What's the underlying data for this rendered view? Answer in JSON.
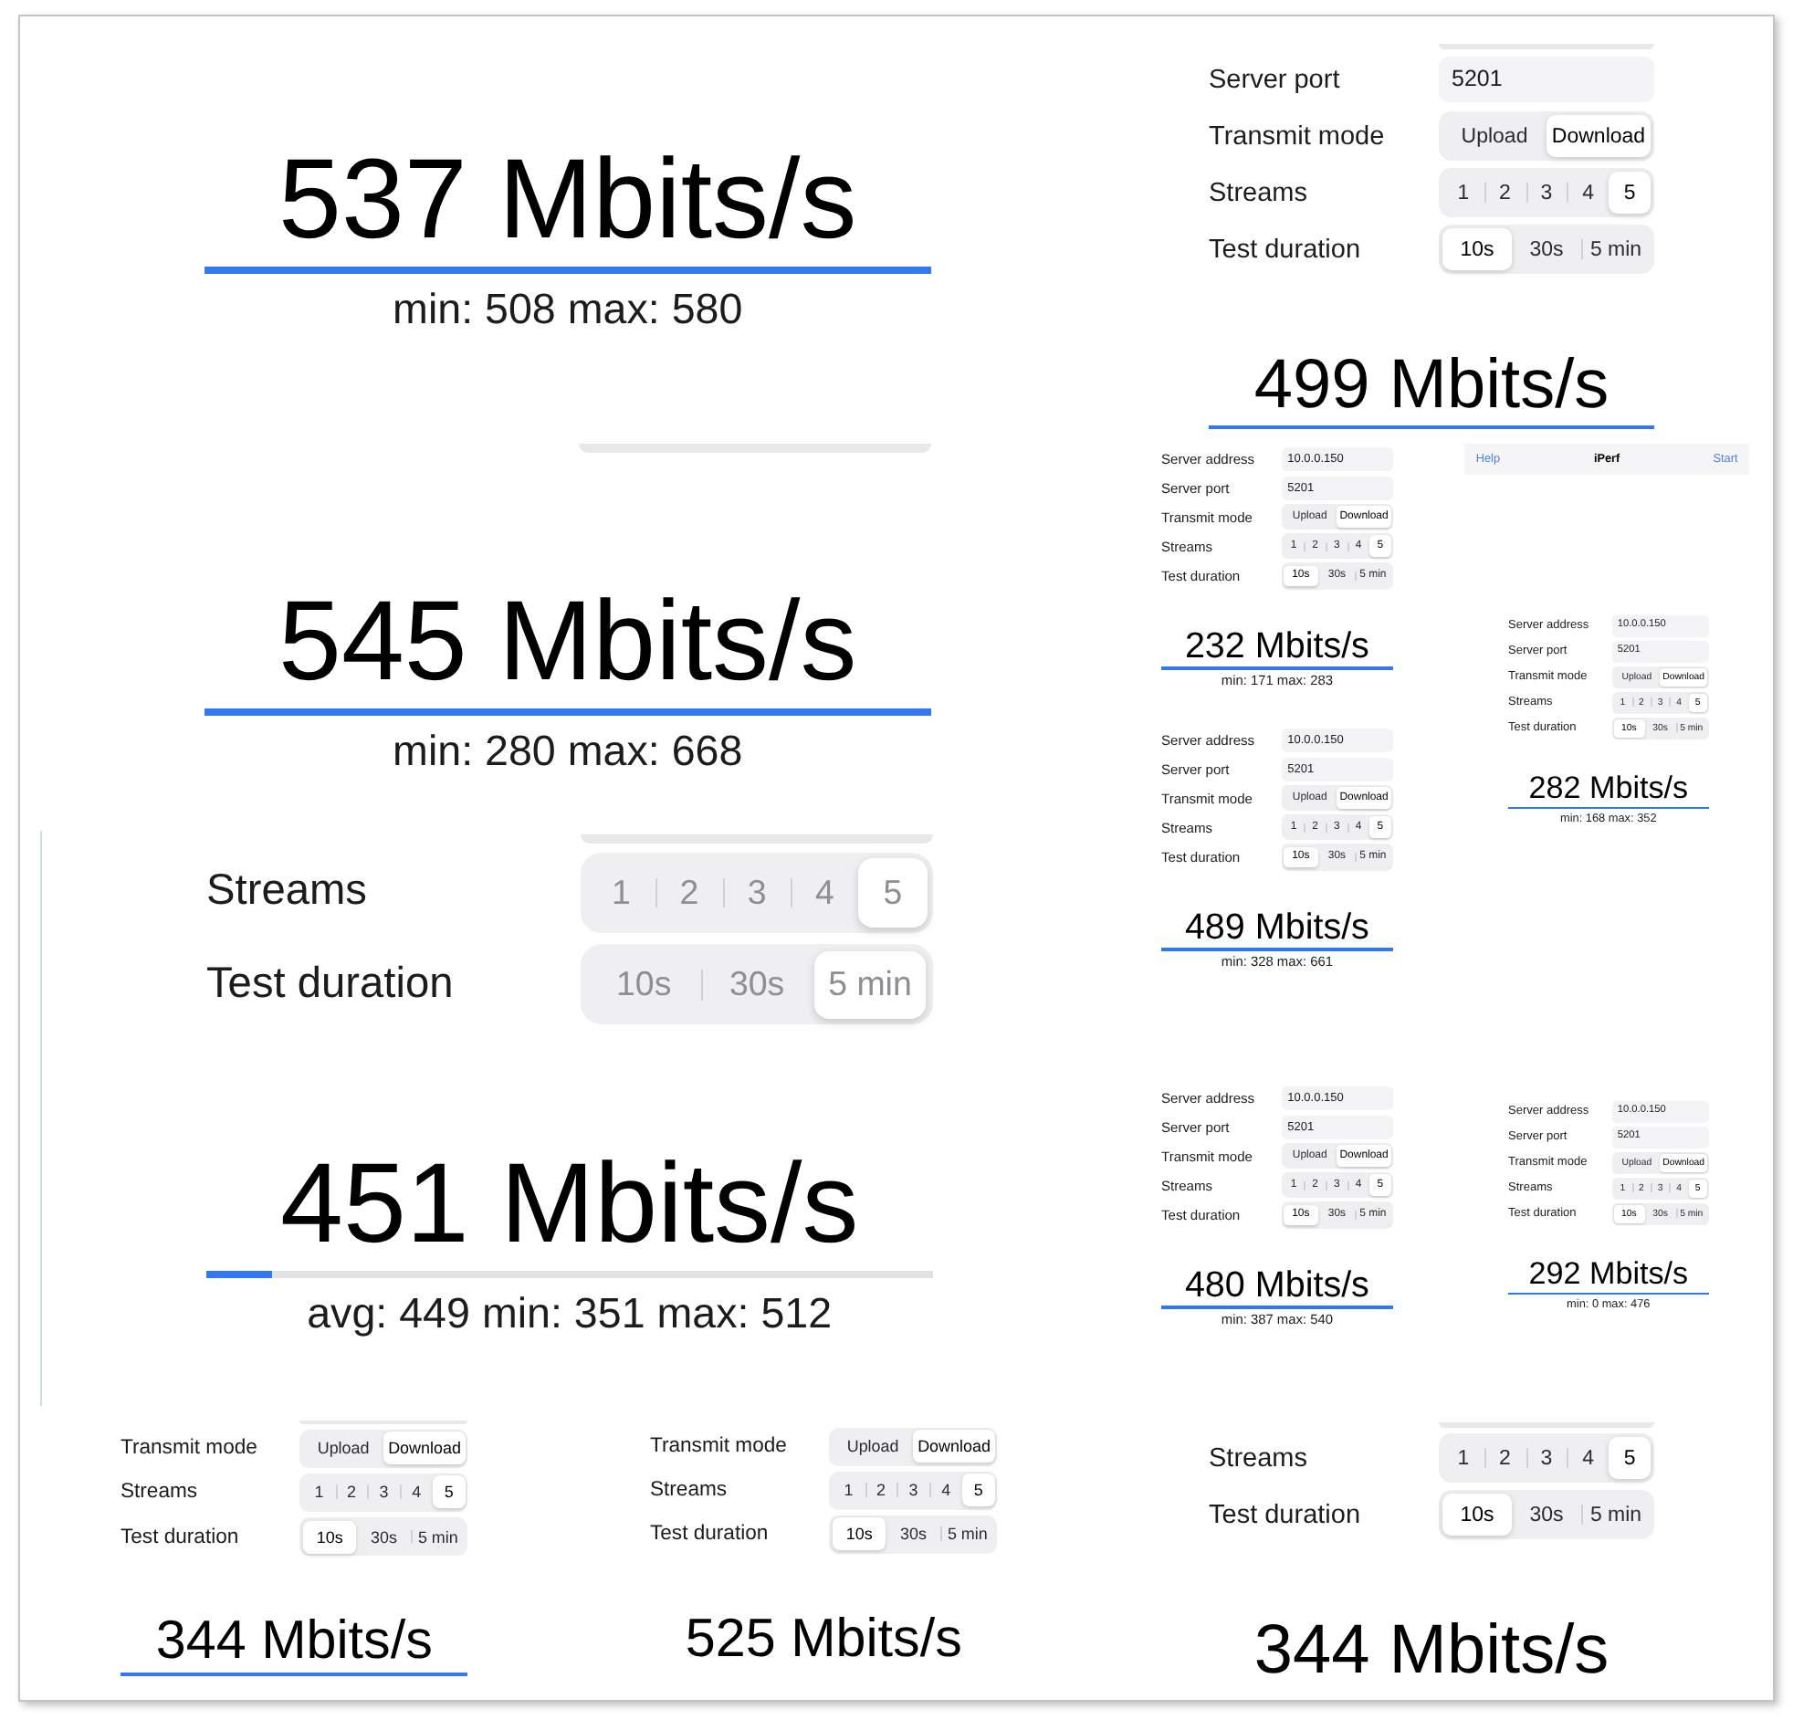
{
  "panels": [
    {
      "items": [
        {
          "kind": "result",
          "speed": "537 Mbits/s",
          "level": 1,
          "stats": "min: 508 max: 580"
        },
        {
          "kind": "edge"
        }
      ]
    },
    {
      "items": [
        {
          "kind": "result",
          "speed": "545 Mbits/s",
          "level": 1,
          "stats": "min: 280 max: 668"
        }
      ]
    },
    {
      "items": [
        {
          "kind": "edge"
        },
        {
          "kind": "segmented",
          "label": "Streams",
          "disabled": true,
          "options": [
            {
              "label": "1",
              "selected": false
            },
            {
              "label": "2",
              "selected": false
            },
            {
              "label": "3",
              "selected": false
            },
            {
              "label": "4",
              "selected": false
            },
            {
              "label": "5",
              "selected": true
            }
          ]
        },
        {
          "kind": "segmented",
          "label": "Test duration",
          "disabled": true,
          "options": [
            {
              "label": "10s",
              "selected": false
            },
            {
              "label": "30s",
              "selected": false
            },
            {
              "label": "5 min",
              "selected": true
            }
          ]
        },
        {
          "kind": "result",
          "speed": "451 Mbits/s",
          "level": 0.09,
          "stats": "avg: 449 min: 351 max: 512"
        }
      ]
    },
    {
      "items": [
        {
          "kind": "edge"
        },
        {
          "kind": "field",
          "label": "Server port",
          "value": "5201",
          "disabled": false
        },
        {
          "kind": "segmented",
          "label": "Transmit mode",
          "disabled": false,
          "options": [
            {
              "label": "Upload",
              "selected": false
            },
            {
              "label": "Download",
              "selected": true
            }
          ]
        },
        {
          "kind": "segmented",
          "label": "Streams",
          "disabled": false,
          "options": [
            {
              "label": "1",
              "selected": false
            },
            {
              "label": "2",
              "selected": false
            },
            {
              "label": "3",
              "selected": false
            },
            {
              "label": "4",
              "selected": false
            },
            {
              "label": "5",
              "selected": true
            }
          ]
        },
        {
          "kind": "segmented",
          "label": "Test duration",
          "disabled": false,
          "options": [
            {
              "label": "10s",
              "selected": true
            },
            {
              "label": "30s",
              "selected": false
            },
            {
              "label": "5 min",
              "selected": false
            }
          ]
        },
        {
          "kind": "result",
          "speed": "499 Mbits/s",
          "level": 1
        }
      ]
    },
    {
      "items": [
        {
          "kind": "field",
          "label": "Server address",
          "value": "10.0.0.150",
          "disabled": false
        },
        {
          "kind": "field",
          "label": "Server port",
          "value": "5201",
          "disabled": false
        },
        {
          "kind": "segmented",
          "label": "Transmit mode",
          "disabled": false,
          "options": [
            {
              "label": "Upload",
              "selected": false
            },
            {
              "label": "Download",
              "selected": true
            }
          ]
        },
        {
          "kind": "segmented",
          "label": "Streams",
          "disabled": false,
          "options": [
            {
              "label": "1",
              "selected": false
            },
            {
              "label": "2",
              "selected": false
            },
            {
              "label": "3",
              "selected": false
            },
            {
              "label": "4",
              "selected": false
            },
            {
              "label": "5",
              "selected": true
            }
          ]
        },
        {
          "kind": "segmented",
          "label": "Test duration",
          "disabled": false,
          "options": [
            {
              "label": "10s",
              "selected": true
            },
            {
              "label": "30s",
              "selected": false
            },
            {
              "label": "5 min",
              "selected": false
            }
          ]
        },
        {
          "kind": "result",
          "speed": "232 Mbits/s",
          "level": 1,
          "stats": "min: 171 max: 283"
        }
      ]
    },
    {
      "items": [
        {
          "kind": "header",
          "left": "Help",
          "title": "iPerf",
          "right": "Start"
        }
      ]
    },
    {
      "items": [
        {
          "kind": "field",
          "label": "Server address",
          "value": "10.0.0.150",
          "disabled": false
        },
        {
          "kind": "field",
          "label": "Server port",
          "value": "5201",
          "disabled": false
        },
        {
          "kind": "segmented",
          "label": "Transmit mode",
          "disabled": false,
          "options": [
            {
              "label": "Upload",
              "selected": false
            },
            {
              "label": "Download",
              "selected": true
            }
          ]
        },
        {
          "kind": "segmented",
          "label": "Streams",
          "disabled": false,
          "options": [
            {
              "label": "1",
              "selected": false
            },
            {
              "label": "2",
              "selected": false
            },
            {
              "label": "3",
              "selected": false
            },
            {
              "label": "4",
              "selected": false
            },
            {
              "label": "5",
              "selected": true
            }
          ]
        },
        {
          "kind": "segmented",
          "label": "Test duration",
          "disabled": false,
          "options": [
            {
              "label": "10s",
              "selected": true
            },
            {
              "label": "30s",
              "selected": false
            },
            {
              "label": "5 min",
              "selected": false
            }
          ]
        },
        {
          "kind": "result",
          "speed": "282 Mbits/s",
          "level": 1,
          "stats": "min: 168 max: 352"
        }
      ]
    },
    {
      "items": [
        {
          "kind": "field",
          "label": "Server address",
          "value": "10.0.0.150",
          "disabled": false
        },
        {
          "kind": "field",
          "label": "Server port",
          "value": "5201",
          "disabled": false
        },
        {
          "kind": "segmented",
          "label": "Transmit mode",
          "disabled": false,
          "options": [
            {
              "label": "Upload",
              "selected": false
            },
            {
              "label": "Download",
              "selected": true
            }
          ]
        },
        {
          "kind": "segmented",
          "label": "Streams",
          "disabled": false,
          "options": [
            {
              "label": "1",
              "selected": false
            },
            {
              "label": "2",
              "selected": false
            },
            {
              "label": "3",
              "selected": false
            },
            {
              "label": "4",
              "selected": false
            },
            {
              "label": "5",
              "selected": true
            }
          ]
        },
        {
          "kind": "segmented",
          "label": "Test duration",
          "disabled": false,
          "options": [
            {
              "label": "10s",
              "selected": true
            },
            {
              "label": "30s",
              "selected": false
            },
            {
              "label": "5 min",
              "selected": false
            }
          ]
        },
        {
          "kind": "result",
          "speed": "489 Mbits/s",
          "level": 1,
          "stats": "min: 328 max: 661"
        }
      ]
    },
    {
      "items": [
        {
          "kind": "field",
          "label": "Server address",
          "value": "10.0.0.150",
          "disabled": false
        },
        {
          "kind": "field",
          "label": "Server port",
          "value": "5201",
          "disabled": false
        },
        {
          "kind": "segmented",
          "label": "Transmit mode",
          "disabled": false,
          "options": [
            {
              "label": "Upload",
              "selected": false
            },
            {
              "label": "Download",
              "selected": true
            }
          ]
        },
        {
          "kind": "segmented",
          "label": "Streams",
          "disabled": false,
          "options": [
            {
              "label": "1",
              "selected": false
            },
            {
              "label": "2",
              "selected": false
            },
            {
              "label": "3",
              "selected": false
            },
            {
              "label": "4",
              "selected": false
            },
            {
              "label": "5",
              "selected": true
            }
          ]
        },
        {
          "kind": "segmented",
          "label": "Test duration",
          "disabled": false,
          "options": [
            {
              "label": "10s",
              "selected": true
            },
            {
              "label": "30s",
              "selected": false
            },
            {
              "label": "5 min",
              "selected": false
            }
          ]
        },
        {
          "kind": "result",
          "speed": "480 Mbits/s",
          "level": 1,
          "stats": "min: 387 max: 540"
        }
      ]
    },
    {
      "items": [
        {
          "kind": "field",
          "label": "Server address",
          "value": "10.0.0.150",
          "disabled": false
        },
        {
          "kind": "field",
          "label": "Server port",
          "value": "5201",
          "disabled": false
        },
        {
          "kind": "segmented",
          "label": "Transmit mode",
          "disabled": false,
          "options": [
            {
              "label": "Upload",
              "selected": false
            },
            {
              "label": "Download",
              "selected": true
            }
          ]
        },
        {
          "kind": "segmented",
          "label": "Streams",
          "disabled": false,
          "options": [
            {
              "label": "1",
              "selected": false
            },
            {
              "label": "2",
              "selected": false
            },
            {
              "label": "3",
              "selected": false
            },
            {
              "label": "4",
              "selected": false
            },
            {
              "label": "5",
              "selected": true
            }
          ]
        },
        {
          "kind": "segmented",
          "label": "Test duration",
          "disabled": false,
          "options": [
            {
              "label": "10s",
              "selected": true
            },
            {
              "label": "30s",
              "selected": false
            },
            {
              "label": "5 min",
              "selected": false
            }
          ]
        },
        {
          "kind": "result",
          "speed": "292 Mbits/s",
          "level": 1,
          "stats": "min: 0 max: 476"
        }
      ]
    },
    {
      "items": [
        {
          "kind": "edge"
        },
        {
          "kind": "segmented",
          "label": "Transmit mode",
          "disabled": false,
          "options": [
            {
              "label": "Upload",
              "selected": false
            },
            {
              "label": "Download",
              "selected": true
            }
          ]
        },
        {
          "kind": "segmented",
          "label": "Streams",
          "disabled": false,
          "options": [
            {
              "label": "1",
              "selected": false
            },
            {
              "label": "2",
              "selected": false
            },
            {
              "label": "3",
              "selected": false
            },
            {
              "label": "4",
              "selected": false
            },
            {
              "label": "5",
              "selected": true
            }
          ]
        },
        {
          "kind": "segmented",
          "label": "Test duration",
          "disabled": false,
          "options": [
            {
              "label": "10s",
              "selected": true
            },
            {
              "label": "30s",
              "selected": false
            },
            {
              "label": "5 min",
              "selected": false
            }
          ]
        },
        {
          "kind": "result",
          "speed": "344 Mbits/s",
          "level": 1
        }
      ]
    },
    {
      "items": [
        {
          "kind": "segmented",
          "label": "Transmit mode",
          "disabled": false,
          "options": [
            {
              "label": "Upload",
              "selected": false
            },
            {
              "label": "Download",
              "selected": true
            }
          ]
        },
        {
          "kind": "segmented",
          "label": "Streams",
          "disabled": false,
          "options": [
            {
              "label": "1",
              "selected": false
            },
            {
              "label": "2",
              "selected": false
            },
            {
              "label": "3",
              "selected": false
            },
            {
              "label": "4",
              "selected": false
            },
            {
              "label": "5",
              "selected": true
            }
          ]
        },
        {
          "kind": "segmented",
          "label": "Test duration",
          "disabled": false,
          "options": [
            {
              "label": "10s",
              "selected": true
            },
            {
              "label": "30s",
              "selected": false
            },
            {
              "label": "5 min",
              "selected": false
            }
          ]
        },
        {
          "kind": "result",
          "speed": "525 Mbits/s"
        }
      ]
    },
    {
      "items": [
        {
          "kind": "edge"
        },
        {
          "kind": "segmented",
          "label": "Streams",
          "disabled": false,
          "options": [
            {
              "label": "1",
              "selected": false
            },
            {
              "label": "2",
              "selected": false
            },
            {
              "label": "3",
              "selected": false
            },
            {
              "label": "4",
              "selected": false
            },
            {
              "label": "5",
              "selected": true
            }
          ]
        },
        {
          "kind": "segmented",
          "label": "Test duration",
          "disabled": false,
          "options": [
            {
              "label": "10s",
              "selected": true
            },
            {
              "label": "30s",
              "selected": false
            },
            {
              "label": "5 min",
              "selected": false
            }
          ]
        },
        {
          "kind": "result",
          "speed": "344 Mbits/s"
        }
      ]
    }
  ]
}
